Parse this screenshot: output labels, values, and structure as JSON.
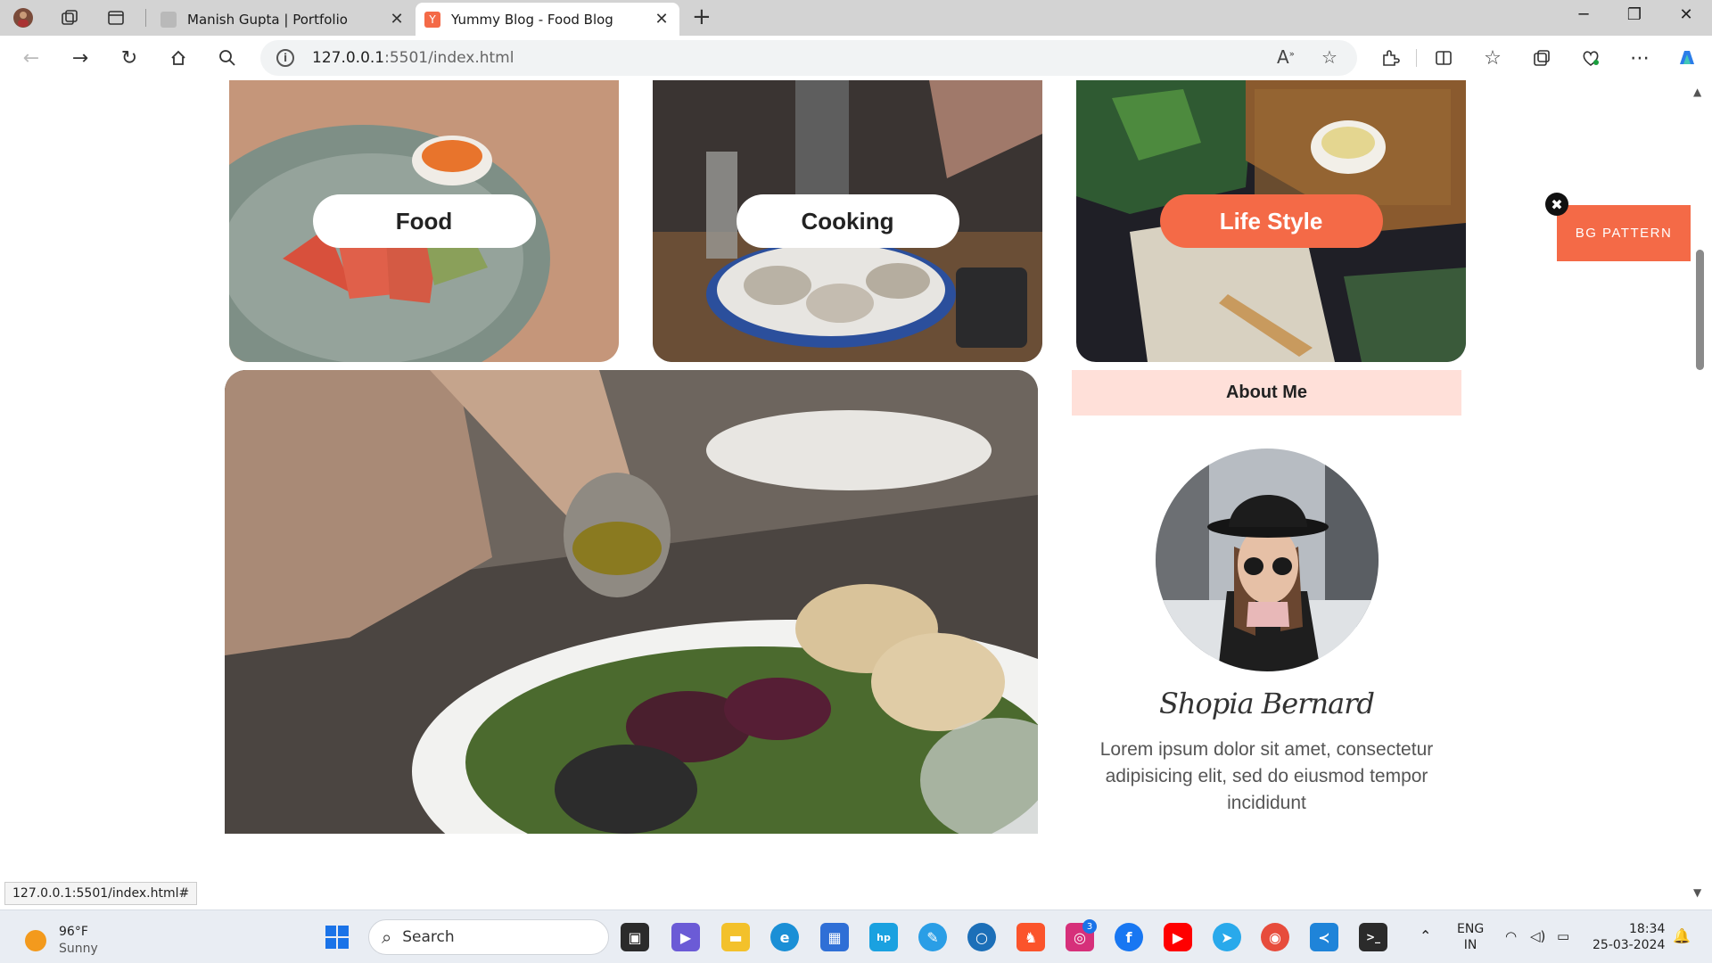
{
  "browser": {
    "tabs": [
      {
        "title": "Manish Gupta | Portfolio",
        "active": false
      },
      {
        "title": "Yummy Blog - Food Blog",
        "active": true
      }
    ],
    "address": {
      "host": "127.0.0.1",
      "path": ":5501/index.html"
    },
    "status_url": "127.0.0.1:5501/index.html#"
  },
  "categories": [
    {
      "label": "Food",
      "style": "white"
    },
    {
      "label": "Cooking",
      "style": "white"
    },
    {
      "label": "Life Style",
      "style": "accent"
    }
  ],
  "sidebar": {
    "about_heading": "About Me",
    "author_name": "Shopia Bernard",
    "bio": "Lorem ipsum dolor sit amet, consectetur adipisicing elit, sed do eiusmod tempor incididunt"
  },
  "floating": {
    "bg_pattern_label": "BG PATTERN",
    "close_glyph": "✖"
  },
  "taskbar": {
    "weather_temp": "96°F",
    "weather_desc": "Sunny",
    "search_label": "Search",
    "language_top": "ENG",
    "language_bottom": "IN",
    "time": "18:34",
    "date": "25-03-2024",
    "instagram_badge": "3"
  },
  "colors": {
    "accent": "#f46a47",
    "about_bg": "#ffe0d9"
  }
}
